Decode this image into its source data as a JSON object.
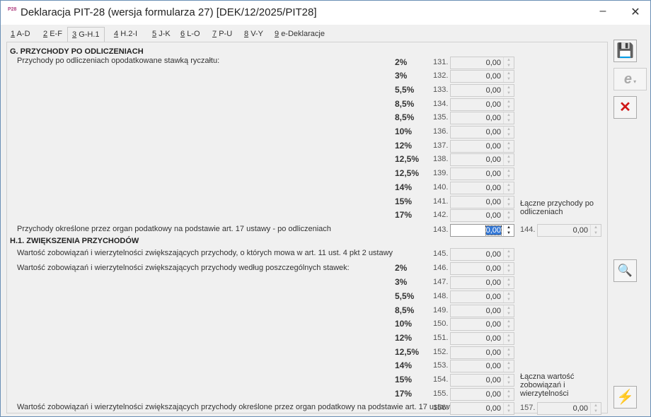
{
  "window": {
    "title": "Deklaracja PIT-28 (wersja formularza 27) [DEK/12/2025/PIT28]",
    "icon_label": "P28",
    "minimize": "–",
    "close": "✕"
  },
  "tabs": [
    {
      "key": "1",
      "label": "A-D"
    },
    {
      "key": "2",
      "label": "E-F"
    },
    {
      "key": "3",
      "label": "G-H.1",
      "active": true
    },
    {
      "key": "4",
      "label": "H.2-I"
    },
    {
      "key": "5",
      "label": "J-K"
    },
    {
      "key": "6",
      "label": "L-O"
    },
    {
      "key": "7",
      "label": "P-U"
    },
    {
      "key": "8",
      "label": "V-Y"
    },
    {
      "key": "9",
      "label": "e-Deklaracje"
    }
  ],
  "sectionG": {
    "title": "G. PRZYCHODY PO ODLICZENIACH",
    "subtitle": "Przychody po odliczeniach opodatkowane stawką ryczałtu:",
    "rows": [
      {
        "rate": "2%",
        "num": "131.",
        "value": "0,00"
      },
      {
        "rate": "3%",
        "num": "132.",
        "value": "0,00"
      },
      {
        "rate": "5,5%",
        "num": "133.",
        "value": "0,00"
      },
      {
        "rate": "8,5%",
        "num": "134.",
        "value": "0,00"
      },
      {
        "rate": "8,5%",
        "num": "135.",
        "value": "0,00"
      },
      {
        "rate": "10%",
        "num": "136.",
        "value": "0,00"
      },
      {
        "rate": "12%",
        "num": "137.",
        "value": "0,00"
      },
      {
        "rate": "12,5%",
        "num": "138.",
        "value": "0,00"
      },
      {
        "rate": "12,5%",
        "num": "139.",
        "value": "0,00"
      },
      {
        "rate": "14%",
        "num": "140.",
        "value": "0,00"
      },
      {
        "rate": "15%",
        "num": "141.",
        "value": "0,00"
      },
      {
        "rate": "17%",
        "num": "142.",
        "value": "0,00"
      }
    ],
    "organ": {
      "label": "Przychody określone przez organ podatkowy na podstawie art. 17 ustawy - po odliczeniach",
      "num": "143.",
      "value": "0,00"
    },
    "total": {
      "label": "Łączne przychody po odliczeniach",
      "num": "144.",
      "value": "0,00"
    }
  },
  "sectionH1": {
    "title": "H.1. ZWIĘKSZENIA PRZYCHODÓW",
    "art11": {
      "label": "Wartość zobowiązań i wierzytelności zwiększających przychody, o których mowa w art. 11 ust. 4 pkt 2 ustawy",
      "num": "145.",
      "value": "0,00"
    },
    "subtitle": "Wartość zobowiązań i wierzytelności zwiększających przychody według poszczególnych stawek:",
    "rows": [
      {
        "rate": "2%",
        "num": "146.",
        "value": "0,00"
      },
      {
        "rate": "3%",
        "num": "147.",
        "value": "0,00"
      },
      {
        "rate": "5,5%",
        "num": "148.",
        "value": "0,00"
      },
      {
        "rate": "8,5%",
        "num": "149.",
        "value": "0,00"
      },
      {
        "rate": "10%",
        "num": "150.",
        "value": "0,00"
      },
      {
        "rate": "12%",
        "num": "151.",
        "value": "0,00"
      },
      {
        "rate": "12,5%",
        "num": "152.",
        "value": "0,00"
      },
      {
        "rate": "14%",
        "num": "153.",
        "value": "0,00"
      },
      {
        "rate": "15%",
        "num": "154.",
        "value": "0,00"
      },
      {
        "rate": "17%",
        "num": "155.",
        "value": "0,00"
      }
    ],
    "organ": {
      "label": "Wartość zobowiązań i wierzytelności zwiększających przychody określone przez organ podatkowy na podstawie art. 17 ustawy",
      "num": "156.",
      "value": "0,00"
    },
    "total": {
      "label": "Łączna wartość zobowiązań i wierzytelności",
      "num": "157.",
      "value": "0,00"
    }
  }
}
